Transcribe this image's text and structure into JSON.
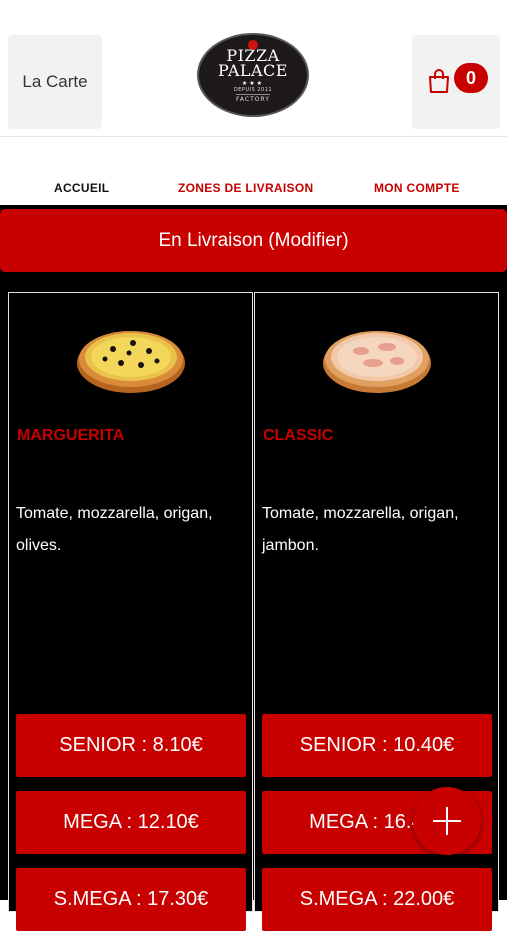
{
  "header": {
    "menu_label": "La Carte",
    "logo": {
      "line1": "PIZZA",
      "line2": "PALACE",
      "stars": "★★★",
      "sub": "DEPUIS 2011",
      "sub2": "FACTORY"
    },
    "cart": {
      "icon": "shopping-bag-icon",
      "count": "0"
    }
  },
  "nav": {
    "items": [
      {
        "label": "ACCUEIL"
      },
      {
        "label": "ZONES DE LIVRAISON"
      },
      {
        "label": "MON COMPTE"
      }
    ]
  },
  "delivery_button": "En Livraison (Modifier)",
  "products": [
    {
      "name": "MARGUERITA",
      "description": "Tomate, mozzarella, origan, olives.",
      "prices": [
        "SENIOR : 8.10€",
        "MEGA : 12.10€",
        "S.MEGA : 17.30€"
      ]
    },
    {
      "name": "CLASSIC",
      "description": "Tomate, mozzarella, origan, jambon.",
      "prices": [
        "SENIOR : 10.40€",
        "MEGA : 16.40€",
        "S.MEGA : 22.00€"
      ]
    }
  ],
  "fab_icon": "plus-icon",
  "colors": {
    "accent": "#c80000",
    "background": "#000000",
    "header": "#ffffff"
  }
}
